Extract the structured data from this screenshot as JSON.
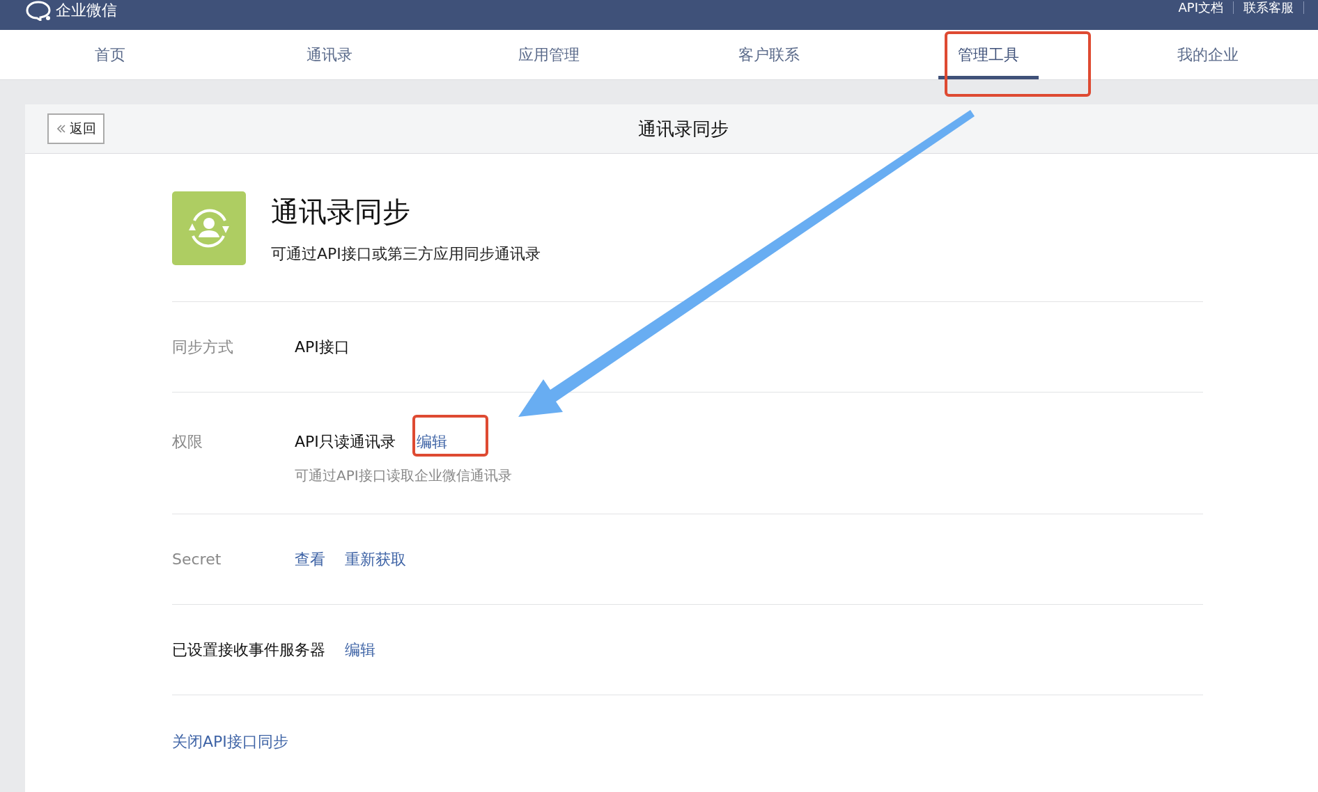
{
  "top_bar": {
    "logo_text": "企业微信",
    "links": [
      "API文档",
      "联系客服"
    ]
  },
  "nav": [
    {
      "label": "首页",
      "selected": false
    },
    {
      "label": "通讯录",
      "selected": false
    },
    {
      "label": "应用管理",
      "selected": false
    },
    {
      "label": "客户联系",
      "selected": false
    },
    {
      "label": "管理工具",
      "selected": true
    },
    {
      "label": "我的企业",
      "selected": false
    }
  ],
  "panel": {
    "back_button": "返回",
    "title": "通讯录同步"
  },
  "app": {
    "name": "通讯录同步",
    "description": "可通过API接口或第三方应用同步通讯录"
  },
  "rows": [
    {
      "kind": "value",
      "label": "同步方式",
      "value": "API接口"
    },
    {
      "kind": "value_link",
      "label": "权限",
      "value": "API只读通讯录",
      "links": [
        "编辑"
      ],
      "note": "可通过API接口读取企业微信通讯录"
    },
    {
      "kind": "links",
      "label": "Secret",
      "links": [
        "查看",
        "重新获取"
      ]
    },
    {
      "kind": "inline",
      "label": "已设置接收事件服务器",
      "links": [
        "编辑"
      ]
    }
  ],
  "footer_link": "关闭API接口同步"
}
